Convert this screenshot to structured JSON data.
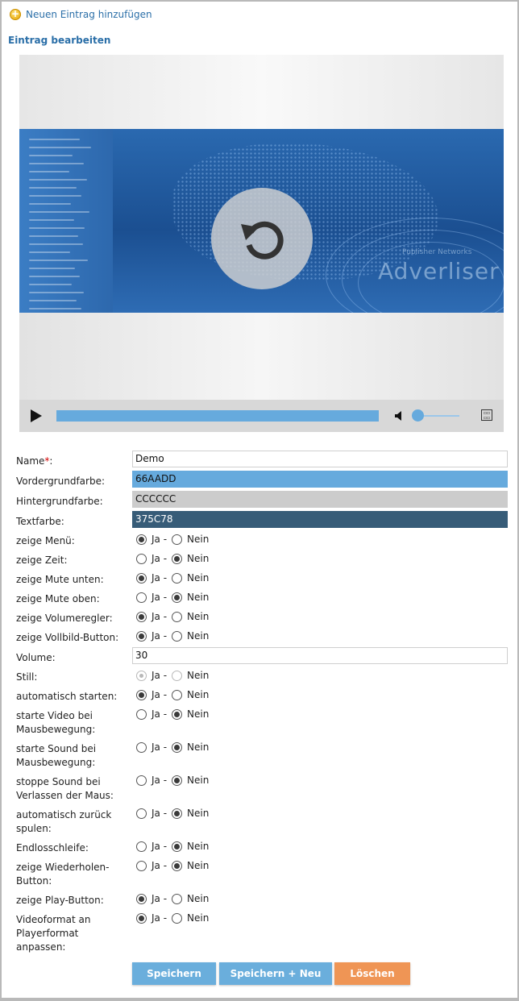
{
  "header": {
    "add_link": "Neuen Eintrag hinzufügen",
    "section_title": "Eintrag bearbeiten"
  },
  "player": {
    "banner_text": "Adverliser",
    "banner_subtext": "Publisher Networks",
    "progress_fraction": 1.0,
    "volume_fraction": 0.0
  },
  "form": {
    "name_label": "Name",
    "required_mark": "*",
    "name_colon": ":",
    "name_value": "Demo",
    "fg_label": "Vordergrundfarbe:",
    "fg_value": "66AADD",
    "bg_label": "Hintergrundfarbe:",
    "bg_value": "CCCCCC",
    "text_label": "Textfarbe:",
    "text_value": "375C78",
    "volume_label": "Volume:",
    "volume_value": "30",
    "yes_label": "Ja -",
    "no_label": "Nein",
    "radio_rows": [
      {
        "label": "zeige Menü:",
        "value": "ja"
      },
      {
        "label": "zeige Zeit:",
        "value": "nein"
      },
      {
        "label": "zeige Mute unten:",
        "value": "ja"
      },
      {
        "label": "zeige Mute oben:",
        "value": "nein"
      },
      {
        "label": "zeige Volumeregler:",
        "value": "ja"
      },
      {
        "label": "zeige Vollbild-Button:",
        "value": "ja"
      },
      {
        "label": "Still:",
        "value": "ja",
        "disabled": true
      },
      {
        "label": "automatisch starten:",
        "value": "ja"
      },
      {
        "label": "starte Video bei Mausbewegung:",
        "value": "nein"
      },
      {
        "label": "starte Sound bei Mausbewegung:",
        "value": "nein"
      },
      {
        "label": "stoppe Sound bei Verlassen der Maus:",
        "value": "nein"
      },
      {
        "label": "automatisch zurück spulen:",
        "value": "nein"
      },
      {
        "label": "Endlosschleife:",
        "value": "nein"
      },
      {
        "label": "zeige Wiederholen-Button:",
        "value": "nein"
      },
      {
        "label": "zeige Play-Button:",
        "value": "ja"
      },
      {
        "label": "Videoformat an Playerformat anpassen:",
        "value": "ja"
      }
    ]
  },
  "buttons": {
    "save": "Speichern",
    "save_new": "Speichern + Neu",
    "delete": "Löschen"
  },
  "colors": {
    "foreground": "#66AADD",
    "background": "#CCCCCC",
    "text": "#375C78",
    "accent": "#2b6fa8",
    "delete": "#ef9555"
  }
}
